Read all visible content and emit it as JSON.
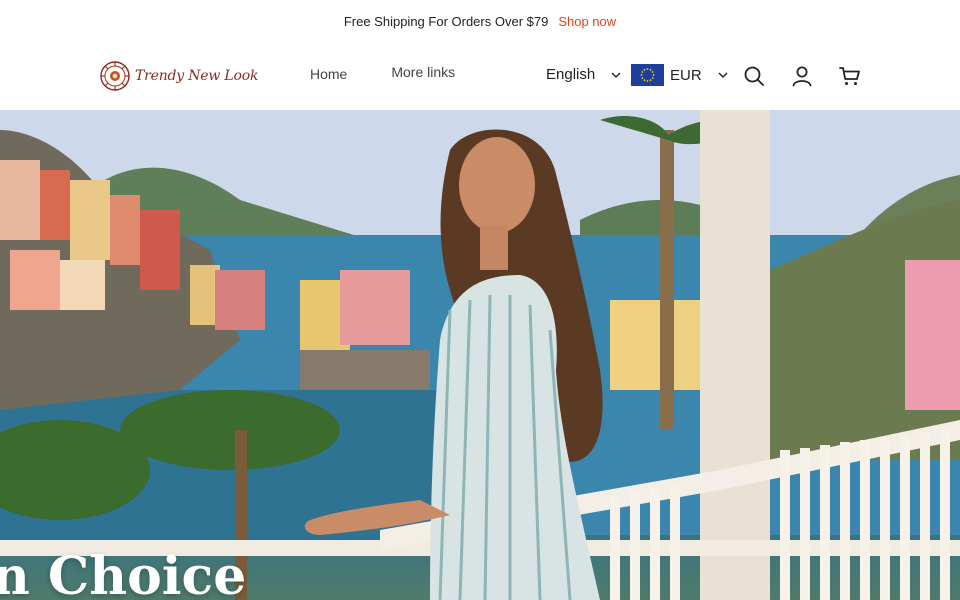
{
  "announcement": {
    "text": "Free Shipping For Orders Over $79",
    "link_label": "Shop now"
  },
  "header": {
    "logo_text": "Trendy New Look",
    "nav": [
      {
        "label": "Home"
      },
      {
        "label": "More links"
      }
    ],
    "language": "English",
    "currency": "EUR",
    "icons": [
      "search-icon",
      "account-icon",
      "cart-icon"
    ]
  },
  "hero": {
    "title": "n Choice"
  },
  "colors": {
    "accent": "#e0421c",
    "logo": "#8b2a1f",
    "flag_blue": "#1d3f9a",
    "flag_star": "#f6d21b"
  }
}
